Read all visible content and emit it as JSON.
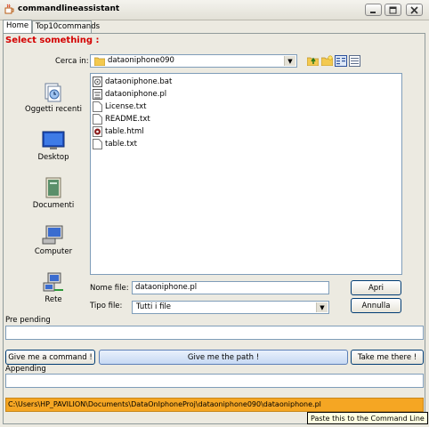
{
  "window": {
    "title": "commandlineassistant",
    "minimize_icon": "minimize-icon",
    "maximize_icon": "maximize-icon",
    "close_icon": "close-icon"
  },
  "tabs": [
    {
      "label": "Home",
      "active": true
    },
    {
      "label": "Top10commands",
      "active": false
    }
  ],
  "header": {
    "prompt": "Select something :",
    "prompt_color": "#d40000"
  },
  "chooser": {
    "look_in_label": "Cerca in:",
    "look_in_value": "dataoniphone090",
    "places": [
      {
        "label": "Oggetti recenti",
        "icon": "recent-items-icon"
      },
      {
        "label": "Desktop",
        "icon": "desktop-icon"
      },
      {
        "label": "Documenti",
        "icon": "documents-icon"
      },
      {
        "label": "Computer",
        "icon": "computer-icon"
      },
      {
        "label": "Rete",
        "icon": "network-icon"
      }
    ],
    "files": [
      {
        "name": "dataoniphone.bat",
        "icon": "bat-file-icon"
      },
      {
        "name": "dataoniphone.pl",
        "icon": "perl-file-icon"
      },
      {
        "name": "License.txt",
        "icon": "text-file-icon"
      },
      {
        "name": "README.txt",
        "icon": "text-file-icon"
      },
      {
        "name": "table.html",
        "icon": "html-file-icon"
      },
      {
        "name": "table.txt",
        "icon": "text-file-icon"
      }
    ],
    "file_name_label": "Nome file:",
    "file_name_value": "dataoniphone.pl",
    "file_type_label": "Tipo file:",
    "file_type_value": "Tutti i file",
    "open_label": "Apri",
    "cancel_label": "Annulla"
  },
  "prepending": {
    "label": "Pre pending",
    "value": ""
  },
  "actions": {
    "command_label": "Give me a command !",
    "path_label": "Give me the path !",
    "take_label": "Take me there !"
  },
  "appending": {
    "label": "Appending",
    "value": ""
  },
  "result": {
    "path": "C:\\Users\\HP_PAVILION\\Documents\\DataOnIphoneProj\\dataoniphone090\\dataoniphone.pl",
    "highlight_color": "#f5a623"
  },
  "tooltip": {
    "text": "Paste this to the Command Line"
  }
}
